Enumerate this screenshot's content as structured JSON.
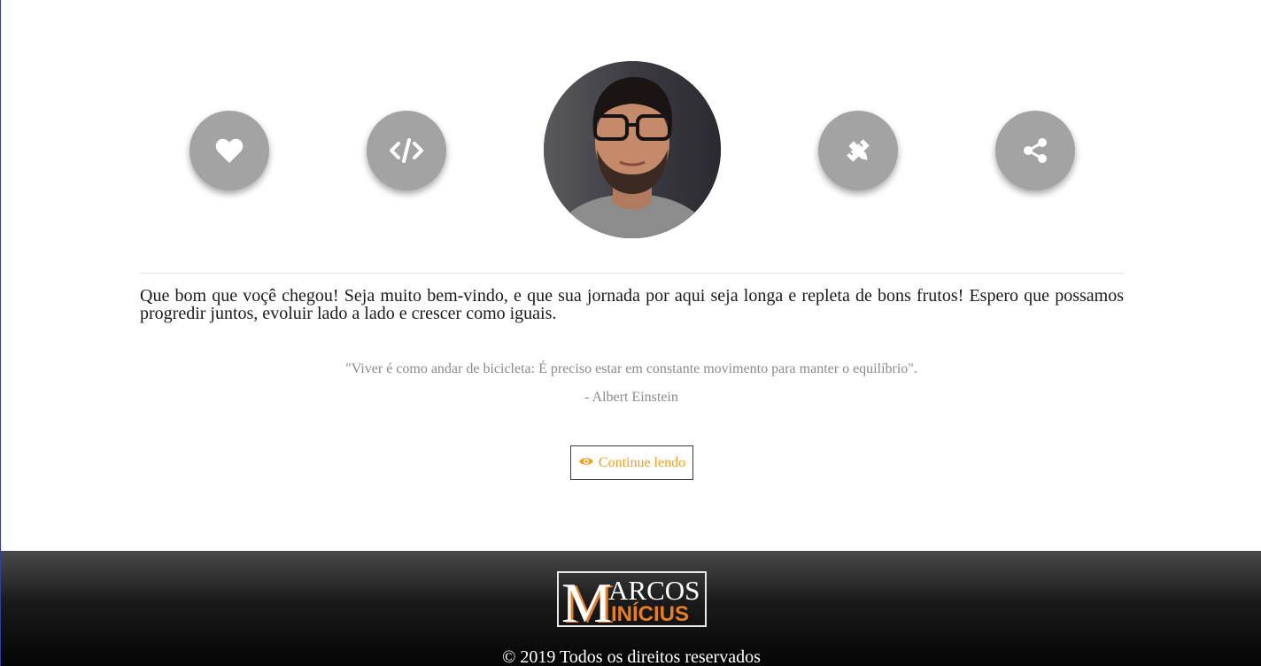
{
  "icons": {
    "heart": "heart-icon",
    "code": "code-icon",
    "design": "pencil-ruler-icon",
    "share": "share-icon",
    "eye": "eye-icon"
  },
  "colors": {
    "icon_circle": "#a3a3a3",
    "accent": "#f0a020",
    "footer_dark": "#050505"
  },
  "content": {
    "welcome": "Que bom que voçê chegou! Seja muito bem-vindo, e que sua jornada por aqui seja longa e repleta de bons frutos! Espero que possamos progredir juntos, evoluir lado a lado e crescer como iguais.",
    "quote": "\"Viver é como andar de bicicleta: É preciso estar em constante movimento para manter o equilíbrio\".",
    "author": "- Albert Einstein",
    "button_label": "Continue lendo"
  },
  "footer": {
    "logo_line1": "ARCOS",
    "logo_line2": "INÍCIUS",
    "logo_initial": "M",
    "copyright": "© 2019 Todos os direitos reservados"
  }
}
